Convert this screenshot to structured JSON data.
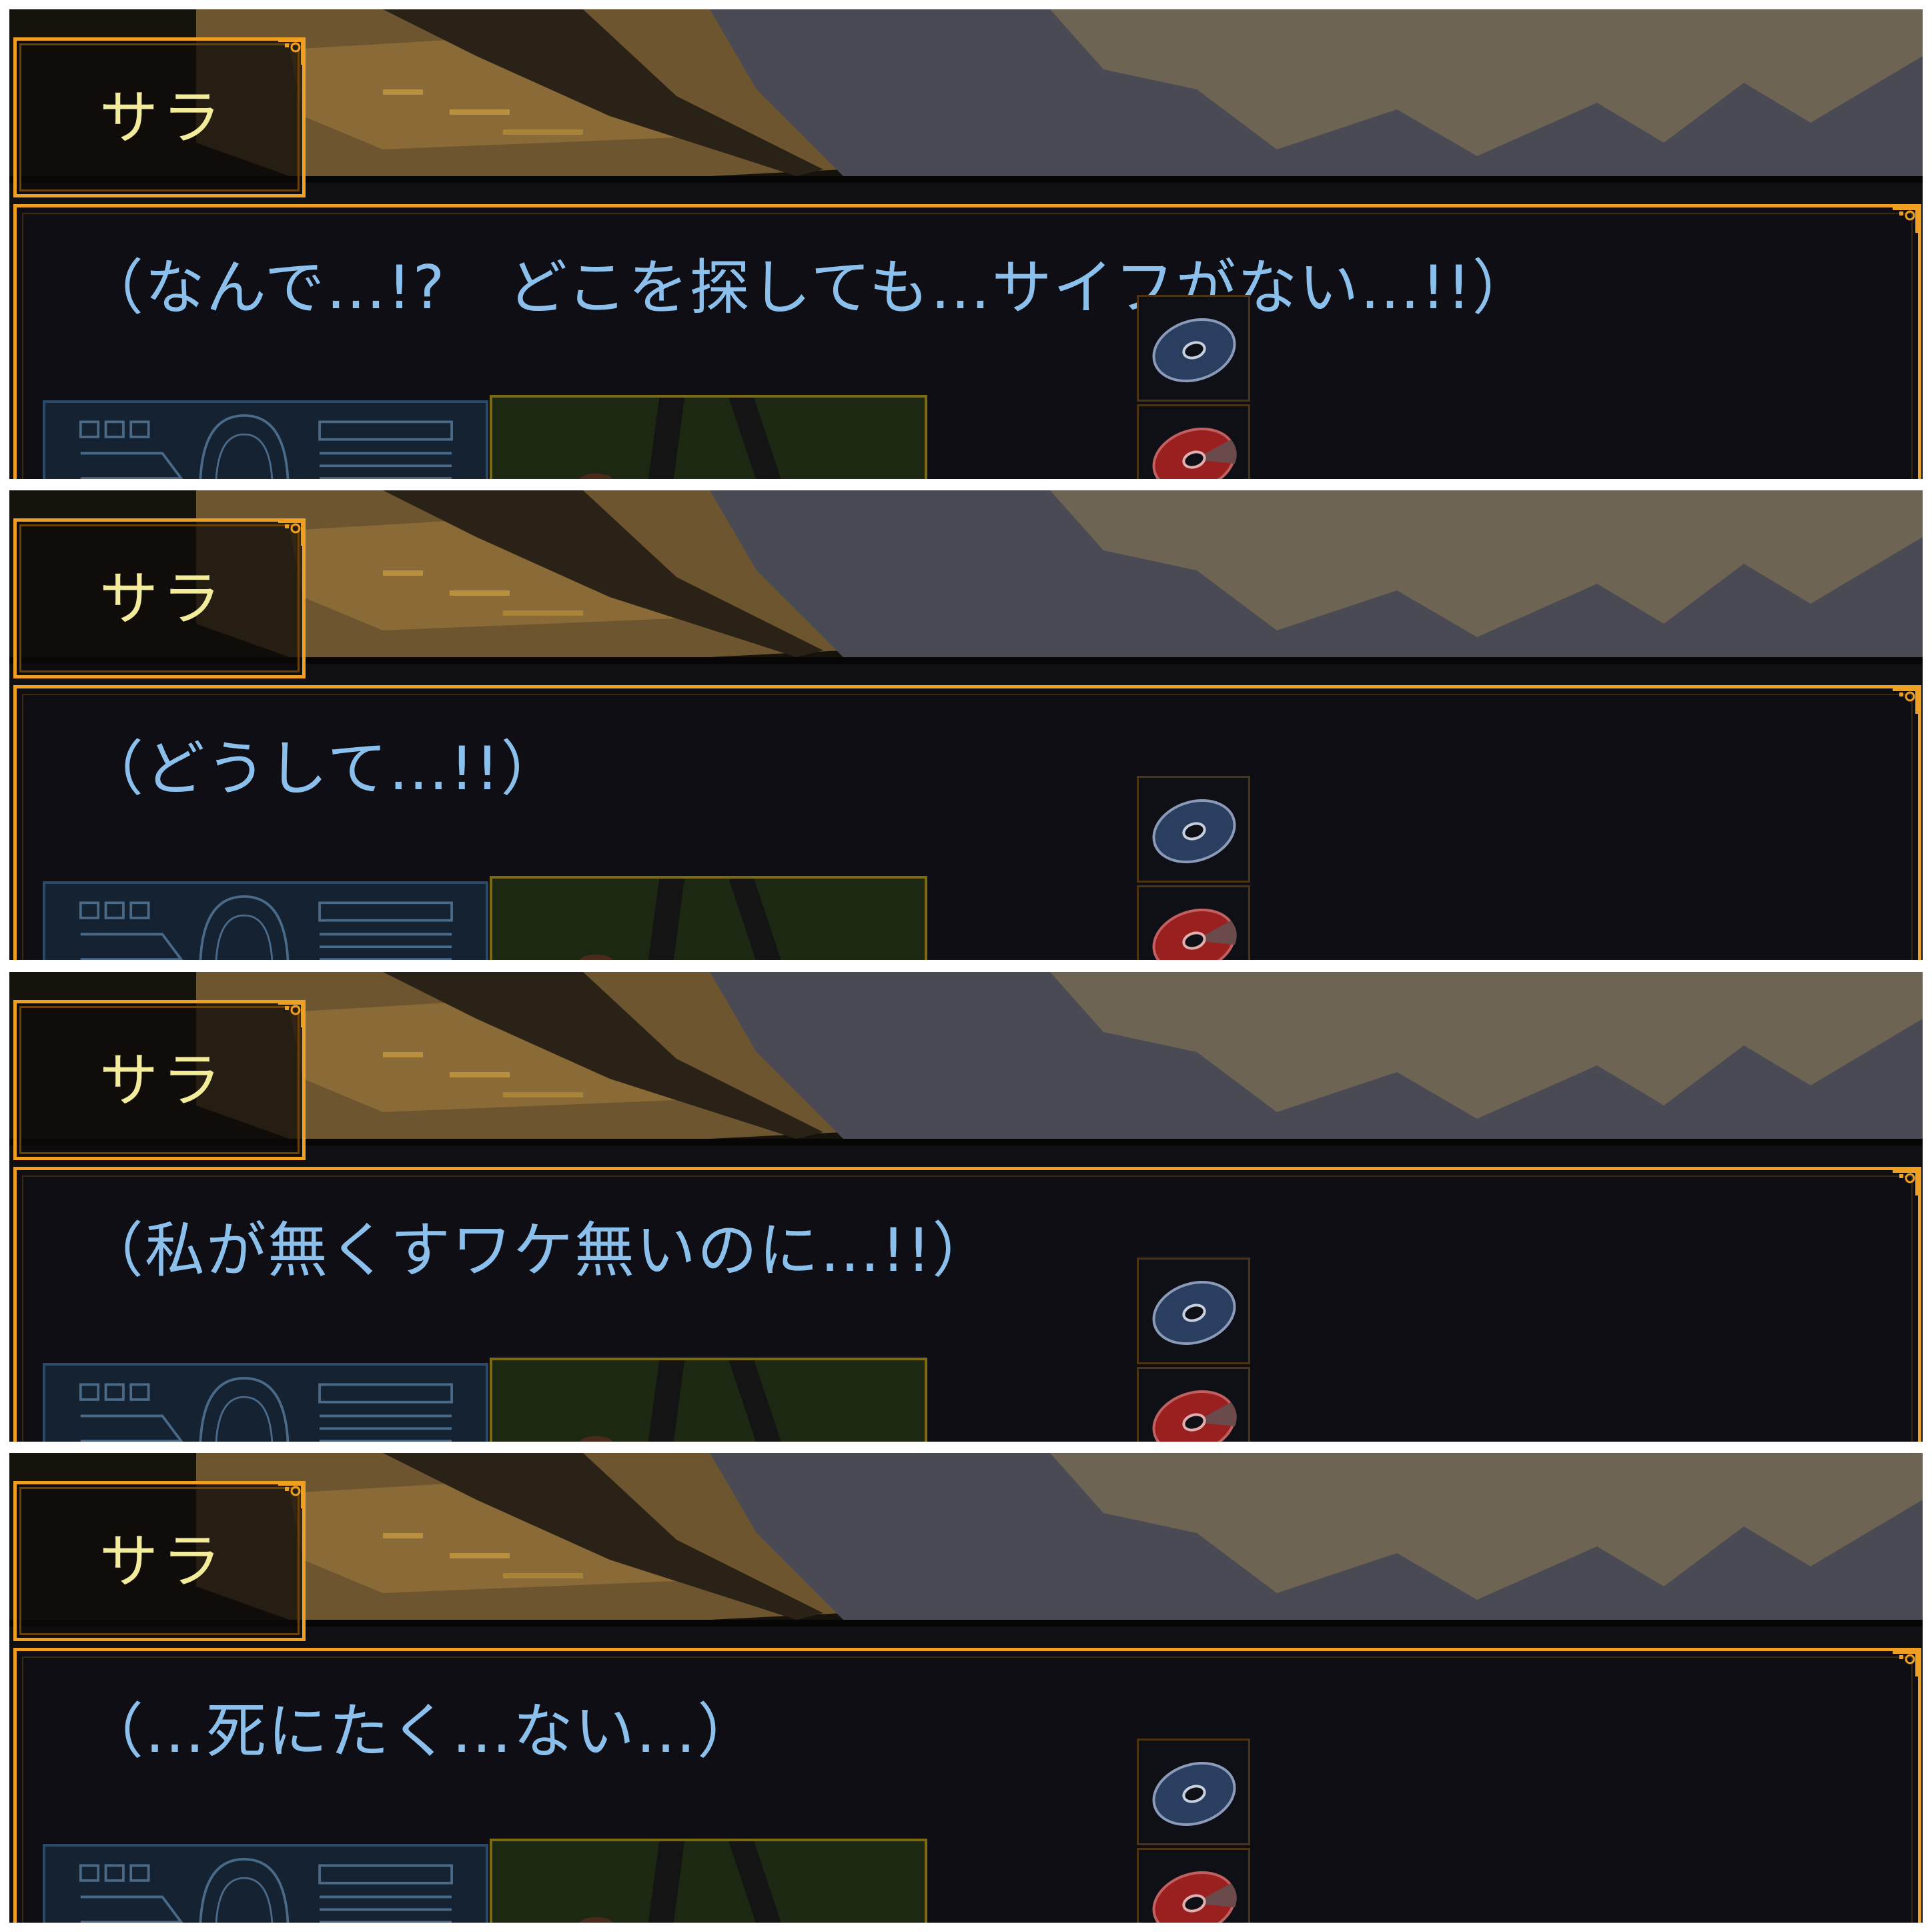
{
  "panels": [
    {
      "speaker": "サラ",
      "line": "（なんで…!?　どこを探しても…サイフがない…!!）"
    },
    {
      "speaker": "サラ",
      "line": "（どうして…!!）"
    },
    {
      "speaker": "サラ",
      "line": "（私が無くすワケ無いのに…!!）"
    },
    {
      "speaker": "サラ",
      "line": "（…死にたく…ない…）"
    }
  ],
  "colors": {
    "frame": "#f0a020",
    "speaker_text": "#f3ec9a",
    "dialogue_text": "#8cc0ec",
    "disc_blue": "#2a3e60",
    "disc_red": "#9a2020"
  },
  "icons": [
    "ornament-corner-icon",
    "disc-blue-icon",
    "disc-red-icon",
    "hud-portrait-icon"
  ]
}
